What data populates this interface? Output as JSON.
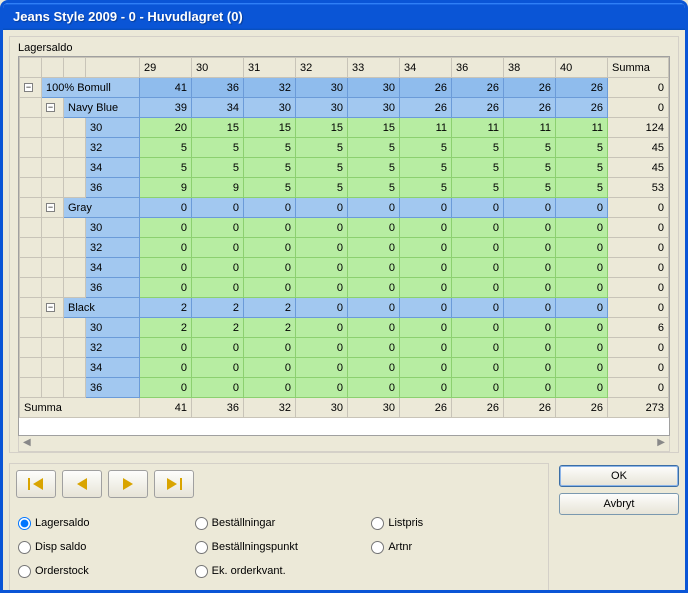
{
  "window": {
    "title": "Jeans Style 2009 - 0 - Huvudlagret (0)"
  },
  "panel": {
    "label": "Lagersaldo"
  },
  "columns": [
    "29",
    "30",
    "31",
    "32",
    "33",
    "34",
    "36",
    "38",
    "40"
  ],
  "summa_col_label": "Summa",
  "tree": {
    "root": {
      "label": "100% Bomull",
      "values": [
        41,
        36,
        32,
        30,
        30,
        26,
        26,
        26,
        26
      ],
      "summa": 0
    },
    "groups": [
      {
        "label": "Navy Blue",
        "values": [
          39,
          34,
          30,
          30,
          30,
          26,
          26,
          26,
          26
        ],
        "summa": 0,
        "rows": [
          {
            "label": "30",
            "values": [
              20,
              15,
              15,
              15,
              15,
              11,
              11,
              11,
              11
            ],
            "summa": 124
          },
          {
            "label": "32",
            "values": [
              5,
              5,
              5,
              5,
              5,
              5,
              5,
              5,
              5
            ],
            "summa": 45
          },
          {
            "label": "34",
            "values": [
              5,
              5,
              5,
              5,
              5,
              5,
              5,
              5,
              5
            ],
            "summa": 45
          },
          {
            "label": "36",
            "values": [
              9,
              9,
              5,
              5,
              5,
              5,
              5,
              5,
              5
            ],
            "summa": 53
          }
        ]
      },
      {
        "label": "Gray",
        "values": [
          0,
          0,
          0,
          0,
          0,
          0,
          0,
          0,
          0
        ],
        "summa": 0,
        "rows": [
          {
            "label": "30",
            "values": [
              0,
              0,
              0,
              0,
              0,
              0,
              0,
              0,
              0
            ],
            "summa": 0
          },
          {
            "label": "32",
            "values": [
              0,
              0,
              0,
              0,
              0,
              0,
              0,
              0,
              0
            ],
            "summa": 0
          },
          {
            "label": "34",
            "values": [
              0,
              0,
              0,
              0,
              0,
              0,
              0,
              0,
              0
            ],
            "summa": 0
          },
          {
            "label": "36",
            "values": [
              0,
              0,
              0,
              0,
              0,
              0,
              0,
              0,
              0
            ],
            "summa": 0
          }
        ]
      },
      {
        "label": "Black",
        "values": [
          2,
          2,
          2,
          0,
          0,
          0,
          0,
          0,
          0
        ],
        "summa": 0,
        "rows": [
          {
            "label": "30",
            "values": [
              2,
              2,
              2,
              0,
              0,
              0,
              0,
              0,
              0
            ],
            "summa": 6
          },
          {
            "label": "32",
            "values": [
              0,
              0,
              0,
              0,
              0,
              0,
              0,
              0,
              0
            ],
            "summa": 0
          },
          {
            "label": "34",
            "values": [
              0,
              0,
              0,
              0,
              0,
              0,
              0,
              0,
              0
            ],
            "summa": 0
          },
          {
            "label": "36",
            "values": [
              0,
              0,
              0,
              0,
              0,
              0,
              0,
              0,
              0
            ],
            "summa": 0
          }
        ]
      }
    ]
  },
  "footer": {
    "label": "Summa",
    "values": [
      41,
      36,
      32,
      30,
      30,
      26,
      26,
      26,
      26
    ],
    "summa": 273
  },
  "radios": [
    {
      "id": "lagersaldo",
      "label": "Lagersaldo",
      "checked": true
    },
    {
      "id": "bestallningar",
      "label": "Beställningar",
      "checked": false
    },
    {
      "id": "listpris",
      "label": "Listpris",
      "checked": false
    },
    {
      "id": "disp",
      "label": "Disp saldo",
      "checked": false
    },
    {
      "id": "bestpunkt",
      "label": "Beställningspunkt",
      "checked": false
    },
    {
      "id": "artnr",
      "label": "Artnr",
      "checked": false
    },
    {
      "id": "orderstock",
      "label": "Orderstock",
      "checked": false
    },
    {
      "id": "ekorder",
      "label": "Ek. orderkvant.",
      "checked": false
    }
  ],
  "actions": {
    "ok": "OK",
    "cancel": "Avbryt"
  }
}
